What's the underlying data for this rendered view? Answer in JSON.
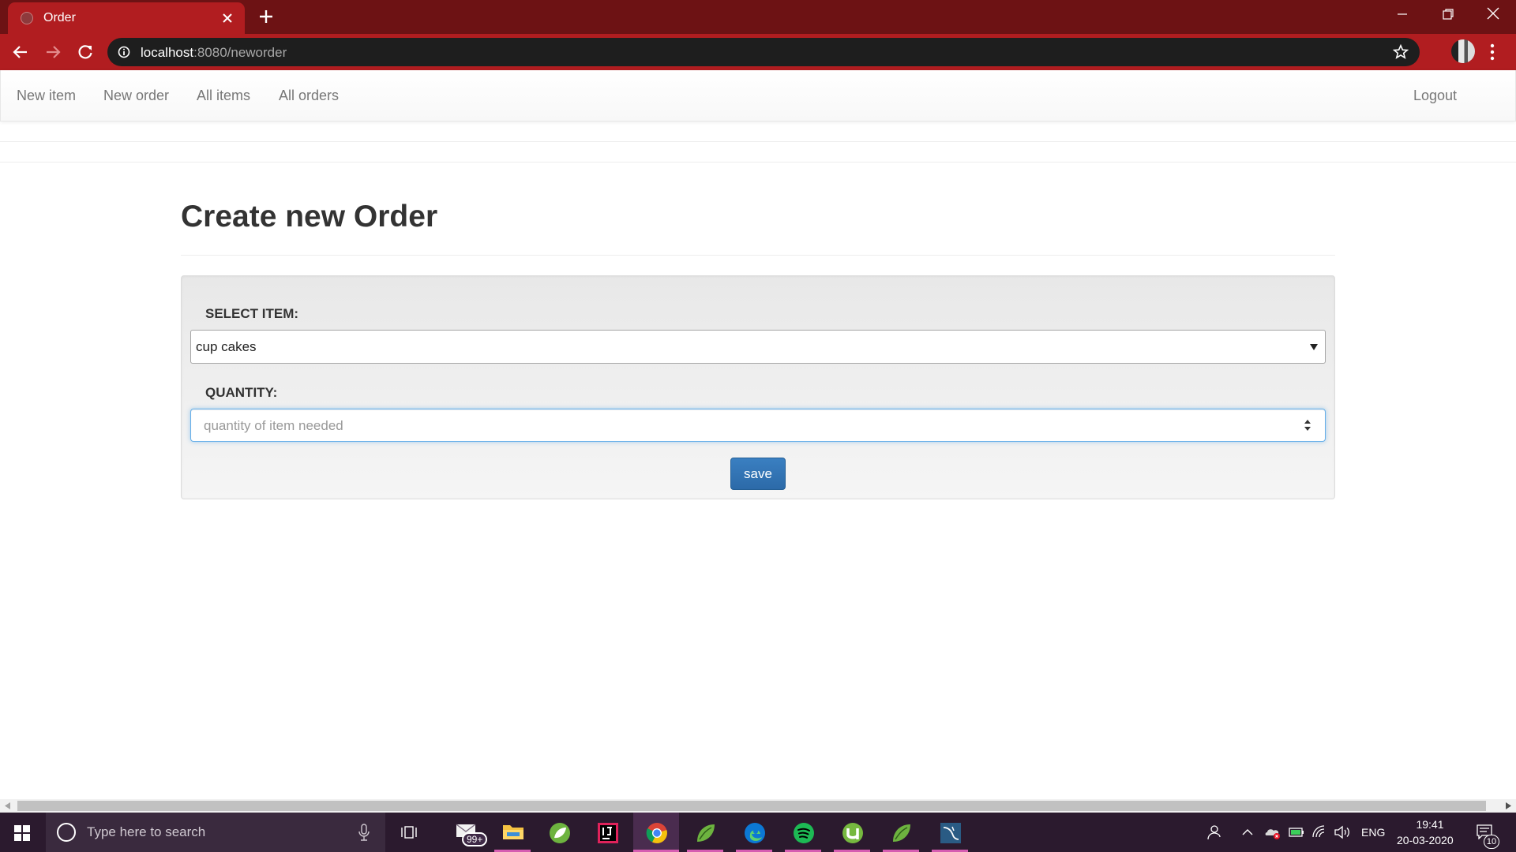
{
  "browser": {
    "tab_title": "Order",
    "url_host": "localhost",
    "url_path": ":8080/neworder"
  },
  "navbar": {
    "links": [
      "New item",
      "New order",
      "All items",
      "All orders"
    ],
    "logout": "Logout"
  },
  "page": {
    "title": "Create new Order",
    "select_label": "SELECT ITEM:",
    "select_value": "cup cakes",
    "quantity_label": "QUANTITY:",
    "quantity_placeholder": "quantity of item needed",
    "save_label": "save"
  },
  "taskbar": {
    "search_placeholder": "Type here to search",
    "mail_badge": "99+",
    "language": "ENG",
    "time": "19:41",
    "date": "20-03-2020",
    "notification_count": "10",
    "apps": [
      "mail-app",
      "file-explorer",
      "spring-tool-suite",
      "intellij-idea",
      "chrome",
      "spring-tool-suite-2",
      "edge",
      "spotify",
      "utorrent",
      "spring-tool-suite-3",
      "mysql-workbench"
    ]
  },
  "colors": {
    "browser_frame": "#6d1214",
    "browser_toolbar": "#b11d20",
    "primary_button": "#337ab7",
    "focus_border": "#66afe9",
    "taskbar": "#2b1a2e"
  }
}
